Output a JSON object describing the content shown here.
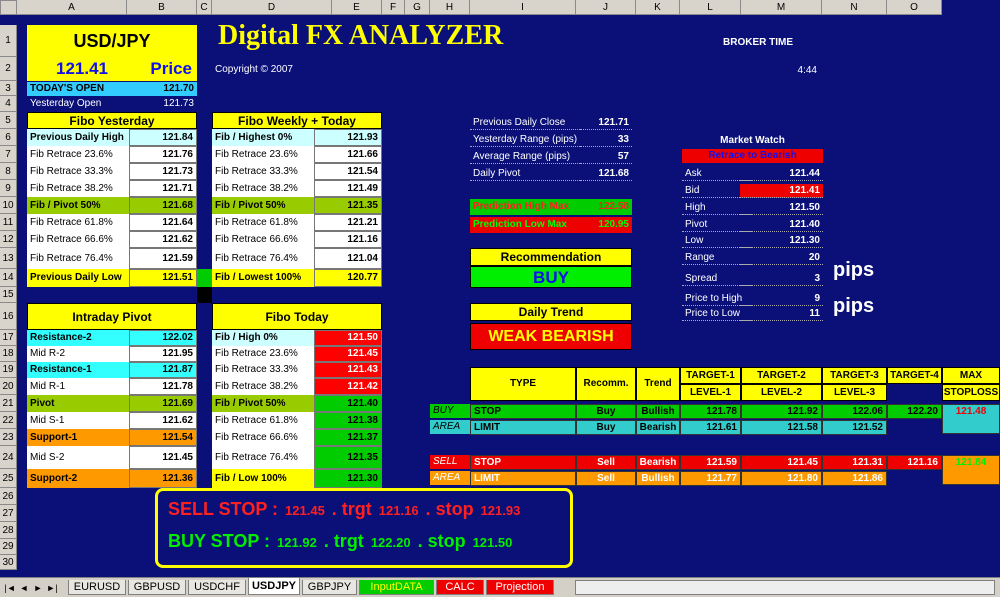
{
  "colheaders": [
    "A",
    "B",
    "C",
    "D",
    "E",
    "F",
    "G",
    "H",
    "I",
    "J",
    "K",
    "L",
    "M",
    "N",
    "O"
  ],
  "rows": [
    "1",
    "2",
    "3",
    "4",
    "5",
    "6",
    "7",
    "8",
    "9",
    "10",
    "11",
    "12",
    "13",
    "14",
    "15",
    "16",
    "17",
    "18",
    "19",
    "20",
    "21",
    "22",
    "23",
    "24",
    "25",
    "26",
    "27",
    "28",
    "29",
    "30"
  ],
  "pair": "USD/JPY",
  "price": "121.41",
  "price_label": "Price",
  "title": "Digital  FX ANALYZER",
  "copyright": "Copyright © 2007",
  "broker_time_label": "BROKER TIME",
  "broker_time": "4:44",
  "todays_open_label": "TODAY'S OPEN",
  "todays_open": "121.70",
  "yesterday_open_label": "Yesterday Open",
  "yesterday_open": "121.73",
  "fibo_yesterday": {
    "title": "Fibo Yesterday",
    "rows": [
      {
        "label": "Previous Daily High",
        "value": "121.84"
      },
      {
        "label": "Fib Retrace 23.6%",
        "value": "121.76"
      },
      {
        "label": "Fib Retrace 33.3%",
        "value": "121.73"
      },
      {
        "label": "Fib Retrace 38.2%",
        "value": "121.71"
      },
      {
        "label": "Fib / Pivot 50%",
        "value": "121.68"
      },
      {
        "label": "Fib Retrace 61.8%",
        "value": "121.64"
      },
      {
        "label": "Fib Retrace 66.6%",
        "value": "121.62"
      },
      {
        "label": "Fib Retrace 76.4%",
        "value": "121.59"
      },
      {
        "label": "Previous Daily Low",
        "value": "121.51"
      }
    ]
  },
  "fibo_weekly": {
    "title": "Fibo Weekly + Today",
    "rows": [
      {
        "label": "Fib / Highest 0%",
        "value": "121.93"
      },
      {
        "label": "Fib Retrace 23.6%",
        "value": "121.66"
      },
      {
        "label": "Fib Retrace 33.3%",
        "value": "121.54"
      },
      {
        "label": "Fib Retrace 38.2%",
        "value": "121.49"
      },
      {
        "label": "Fib / Pivot 50%",
        "value": "121.35"
      },
      {
        "label": "Fib Retrace 61.8%",
        "value": "121.21"
      },
      {
        "label": "Fib Retrace 66.6%",
        "value": "121.16"
      },
      {
        "label": "Fib Retrace 76.4%",
        "value": "121.04"
      },
      {
        "label": "Fib / Lowest 100%",
        "value": "120.77"
      }
    ]
  },
  "intraday": {
    "title": "Intraday Pivot",
    "rows": [
      {
        "label": "Resistance-2",
        "value": "122.02"
      },
      {
        "label": "Mid R-2",
        "value": "121.95"
      },
      {
        "label": "Resistance-1",
        "value": "121.87"
      },
      {
        "label": "Mid R-1",
        "value": "121.78"
      },
      {
        "label": "Pivot",
        "value": "121.69"
      },
      {
        "label": "Mid S-1",
        "value": "121.62"
      },
      {
        "label": "Support-1",
        "value": "121.54"
      },
      {
        "label": "Mid S-2",
        "value": "121.45"
      },
      {
        "label": "Support-2",
        "value": "121.36"
      }
    ]
  },
  "fibo_today": {
    "title": "Fibo Today",
    "rows": [
      {
        "label": "Fib / High 0%",
        "value": "121.50"
      },
      {
        "label": "Fib Retrace 23.6%",
        "value": "121.45"
      },
      {
        "label": "Fib Retrace 33.3%",
        "value": "121.43"
      },
      {
        "label": "Fib Retrace 38.2%",
        "value": "121.42"
      },
      {
        "label": "Fib / Pivot 50%",
        "value": "121.40"
      },
      {
        "label": "Fib Retrace 61.8%",
        "value": "121.38"
      },
      {
        "label": "Fib Retrace 66.6%",
        "value": "121.37"
      },
      {
        "label": "Fib Retrace 76.4%",
        "value": "121.35"
      },
      {
        "label": "Fib / Low 100%",
        "value": "121.30"
      }
    ]
  },
  "stats": [
    {
      "label": "Previous Daily Close",
      "value": "121.71"
    },
    {
      "label": "Yesterday Range (pips)",
      "value": "33"
    },
    {
      "label": "Average Range (pips)",
      "value": "57"
    },
    {
      "label": "Daily Pivot",
      "value": "121.68"
    }
  ],
  "prediction_high_label": "Prediction High Max",
  "prediction_high": "122.58",
  "prediction_low_label": "Prediction Low Max",
  "prediction_low": "120.95",
  "recommendation_label": "Recommendation",
  "recommendation": "BUY",
  "daily_trend_label": "Daily Trend",
  "daily_trend": "WEAK BEARISH",
  "market_watch": {
    "title": "Market Watch",
    "status": "Retrace to Bearish",
    "rows": [
      {
        "label": "Ask",
        "value": "121.44"
      },
      {
        "label": "Bid",
        "value": "121.41"
      },
      {
        "label": "High",
        "value": "121.50"
      },
      {
        "label": "Pivot",
        "value": "121.40"
      },
      {
        "label": "Low",
        "value": "121.30"
      },
      {
        "label": "Range",
        "value": "20"
      },
      {
        "label": "Spread",
        "value": "3"
      },
      {
        "label": "Price to High",
        "value": "9"
      },
      {
        "label": "Price to Low",
        "value": "11"
      }
    ],
    "pips1": "pips",
    "pips2": "pips"
  },
  "trade_table": {
    "headers": {
      "type": "TYPE",
      "recomm": "Recomm.",
      "trend": "Trend",
      "t1": "TARGET-1",
      "t2": "TARGET-2",
      "t3": "TARGET-3",
      "t4": "TARGET-4",
      "l1": "LEVEL-1",
      "l2": "LEVEL-2",
      "l3": "LEVEL-3",
      "max": "MAX",
      "stoploss": "STOPLOSS"
    },
    "buy_label": "BUY",
    "buy_area": "AREA",
    "sell_label": "SELL",
    "sell_area": "AREA",
    "rows": [
      {
        "type": "STOP",
        "recomm": "Buy",
        "trend": "Bullish",
        "t1": "121.78",
        "t2": "121.92",
        "t3": "122.06",
        "t4": "122.20",
        "sl": "121.48"
      },
      {
        "type": "LIMIT",
        "recomm": "Buy",
        "trend": "Bearish",
        "t1": "121.61",
        "t2": "121.58",
        "t3": "121.52",
        "t4": "",
        "sl": ""
      },
      {
        "type": "STOP",
        "recomm": "Sell",
        "trend": "Bearish",
        "t1": "121.59",
        "t2": "121.45",
        "t3": "121.31",
        "t4": "121.16",
        "sl": "121.84"
      },
      {
        "type": "LIMIT",
        "recomm": "Sell",
        "trend": "Bullish",
        "t1": "121.77",
        "t2": "121.80",
        "t3": "121.86",
        "t4": "",
        "sl": ""
      }
    ]
  },
  "summary": {
    "sell": {
      "label": "SELL STOP :",
      "v1": "121.45",
      "trgt": ". trgt",
      "v2": "121.16",
      "stop": ". stop",
      "v3": "121.93"
    },
    "buy": {
      "label": "BUY STOP :",
      "v1": "121.92",
      "trgt": ". trgt",
      "v2": "122.20",
      "stop": ". stop",
      "v3": "121.50"
    }
  },
  "tabs": [
    "EURUSD",
    "GBPUSD",
    "USDCHF",
    "USDJPY",
    "GBPJPY",
    "InputDATA",
    "CALC",
    "Projection"
  ],
  "active_tab": "USDJPY",
  "colors": {
    "bg": "#0a1078",
    "yellow": "#ffff00",
    "cyan": "#33ccff",
    "green": "#99cc00",
    "red": "#ff0000",
    "orange": "#ff9900",
    "lightcyan": "#ccffff",
    "limegreen": "#00ff00",
    "teal": "#33cccc"
  }
}
